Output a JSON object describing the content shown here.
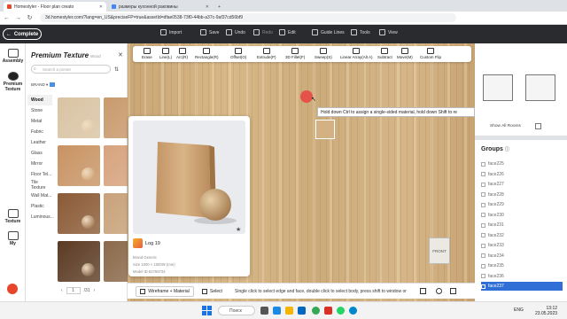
{
  "browser": {
    "tabs": [
      {
        "title": "Homestyler - Floor plan creato"
      },
      {
        "title": "размеры кухонной раковины"
      }
    ],
    "url": "3d.homestyler.com/?lang=en_US&preciseFP=true&assetId=dfae0538-73f0-44bb-a37c-9af37cd56bf9"
  },
  "header": {
    "complete_label": "Complete",
    "buttons": [
      "Import",
      "Save",
      "Undo",
      "Redo",
      "Edit",
      "Guide Lines",
      "Tools",
      "View"
    ]
  },
  "rail": {
    "items": [
      "Assembly",
      "Premium Texture",
      "Texture",
      "My"
    ]
  },
  "panel": {
    "title": "Premium Texture",
    "subtitle": "Wood",
    "search_placeholder": "Search a preset",
    "brand_label": "BRAND",
    "categories": [
      "Wood",
      "Stone",
      "Metal",
      "Fabric",
      "Leather",
      "Glass",
      "Mirror",
      "Floor Tel...",
      "Tile Texture",
      "Wall Mat...",
      "Plastic",
      "Luminous..."
    ],
    "selected_category": "Wood",
    "pager": {
      "current": "1",
      "total": "/31"
    }
  },
  "toolbar": {
    "tools": [
      "Erase",
      "Line(L)",
      "Arc(R)",
      "Rectangle(R)",
      "Offset(O)",
      "Extrude(P)",
      "3D Fillet(F)",
      "Sweep(S)",
      "Linear Array(Alt A)",
      "Subtract",
      "Move(M)",
      "Custom Flip"
    ]
  },
  "tooltip": "Hold down Ctrl to assign a single-sided material, hold down Shift to re",
  "viewcube_label": "FRONT",
  "preview": {
    "name": "Log 19",
    "brand": "Brand Generic",
    "size": "Size 1000 × 1000W (mm)",
    "model": "Model ID 52769724"
  },
  "bottom": {
    "wireframe_label": "Wireframe + Material",
    "select_label": "Select",
    "hint": "Single click to select edge and face, double click to select body, press shift to window or"
  },
  "views": {
    "show_all": "Show All Rooms"
  },
  "groups": {
    "title": "Groups",
    "items": [
      "face225",
      "face226",
      "face227",
      "face228",
      "face229",
      "face230",
      "face231",
      "face232",
      "face233",
      "face234",
      "face235",
      "face236",
      "face237"
    ],
    "selected": "face237"
  },
  "taskbar": {
    "search": "Поиск",
    "lang": "ENG",
    "time": "13:12",
    "date": "23.05.2023"
  }
}
